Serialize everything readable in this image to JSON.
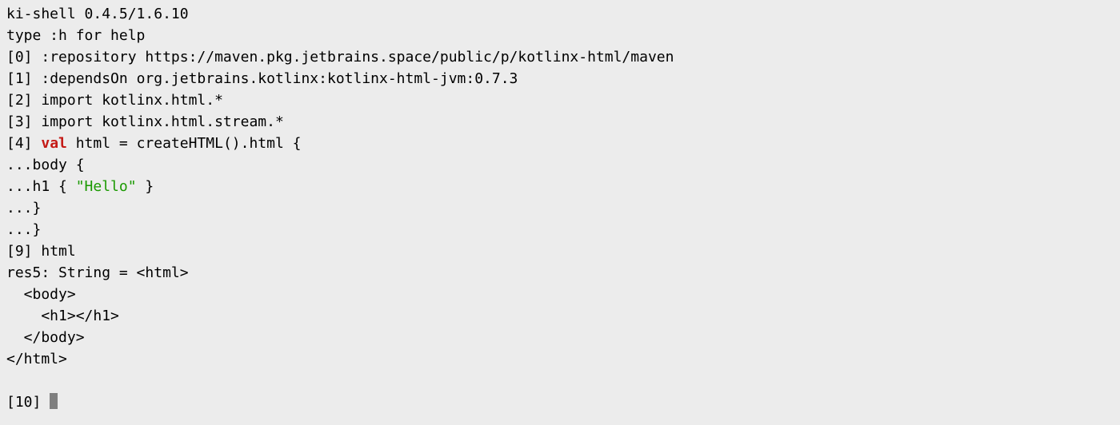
{
  "header": {
    "version": "ki-shell 0.4.5/1.6.10",
    "help": "type :h for help"
  },
  "lines": {
    "l0_prefix": "[0] ",
    "l0_cmd": ":repository https://maven.pkg.jetbrains.space/public/p/kotlinx-html/maven",
    "l1_prefix": "[1] ",
    "l1_cmd": ":dependsOn org.jetbrains.kotlinx:kotlinx-html-jvm:0.7.3",
    "l2_prefix": "[2] ",
    "l2_cmd": "import kotlinx.html.*",
    "l3_prefix": "[3] ",
    "l3_cmd": "import kotlinx.html.stream.*",
    "l4_prefix": "[4] ",
    "l4_kw": "val",
    "l4_rest": " html = createHTML().html {",
    "l5_prefix": "...",
    "l5_cmd": "body {",
    "l6_prefix": "...",
    "l6_pre": "h1 { ",
    "l6_str": "\"Hello\"",
    "l6_post": " }",
    "l7_prefix": "...",
    "l7_cmd": "}",
    "l8_prefix": "...",
    "l8_cmd": "}",
    "l9_prefix": "[9] ",
    "l9_cmd": "html"
  },
  "result": {
    "r1": "res5: String = <html>",
    "r2": "  <body>",
    "r3": "    <h1></h1>",
    "r4": "  </body>",
    "r5": "</html>"
  },
  "prompt": {
    "prefix": "[10] "
  }
}
